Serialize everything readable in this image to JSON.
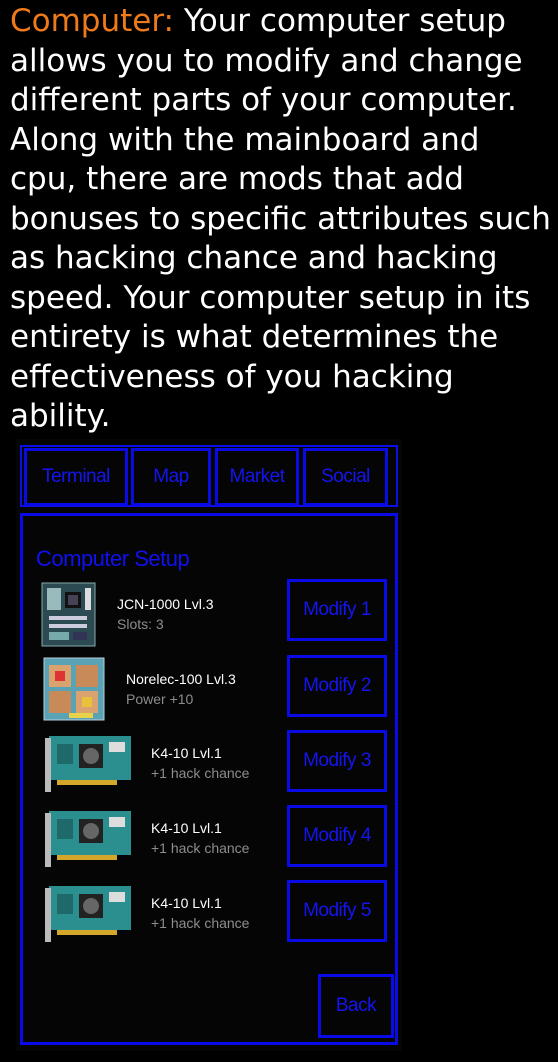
{
  "intro": {
    "highlight": "Computer:",
    "text": " Your computer setup allows you to modify and change different parts of your computer. Along with the mainboard and cpu, there are mods that add bonuses to specific attributes such as hacking chance and hacking speed. Your computer setup in its entirety is what determines the effectiveness of you hacking ability."
  },
  "tabs": [
    "Terminal",
    "Map",
    "Market",
    "Social"
  ],
  "panel": {
    "title": "Computer Setup",
    "components": [
      {
        "name": "JCN-1000 Lvl.3",
        "detail": "Slots: 3",
        "icon": "mainboard-icon",
        "button": "Modify 1"
      },
      {
        "name": "Norelec-100 Lvl.3",
        "detail": "Power +10",
        "icon": "cpu-icon",
        "button": "Modify 2"
      },
      {
        "name": "K4-10 Lvl.1",
        "detail": "+1 hack chance",
        "icon": "graphics-card-icon",
        "button": "Modify 3"
      },
      {
        "name": "K4-10 Lvl.1",
        "detail": "+1 hack chance",
        "icon": "graphics-card-icon",
        "button": "Modify 4"
      },
      {
        "name": "K4-10 Lvl.1",
        "detail": "+1 hack chance",
        "icon": "graphics-card-icon",
        "button": "Modify 5"
      }
    ],
    "back_label": "Back"
  },
  "colors": {
    "highlight": "#ef7a1a",
    "accent": "#0a0ae6",
    "background": "#000000"
  }
}
